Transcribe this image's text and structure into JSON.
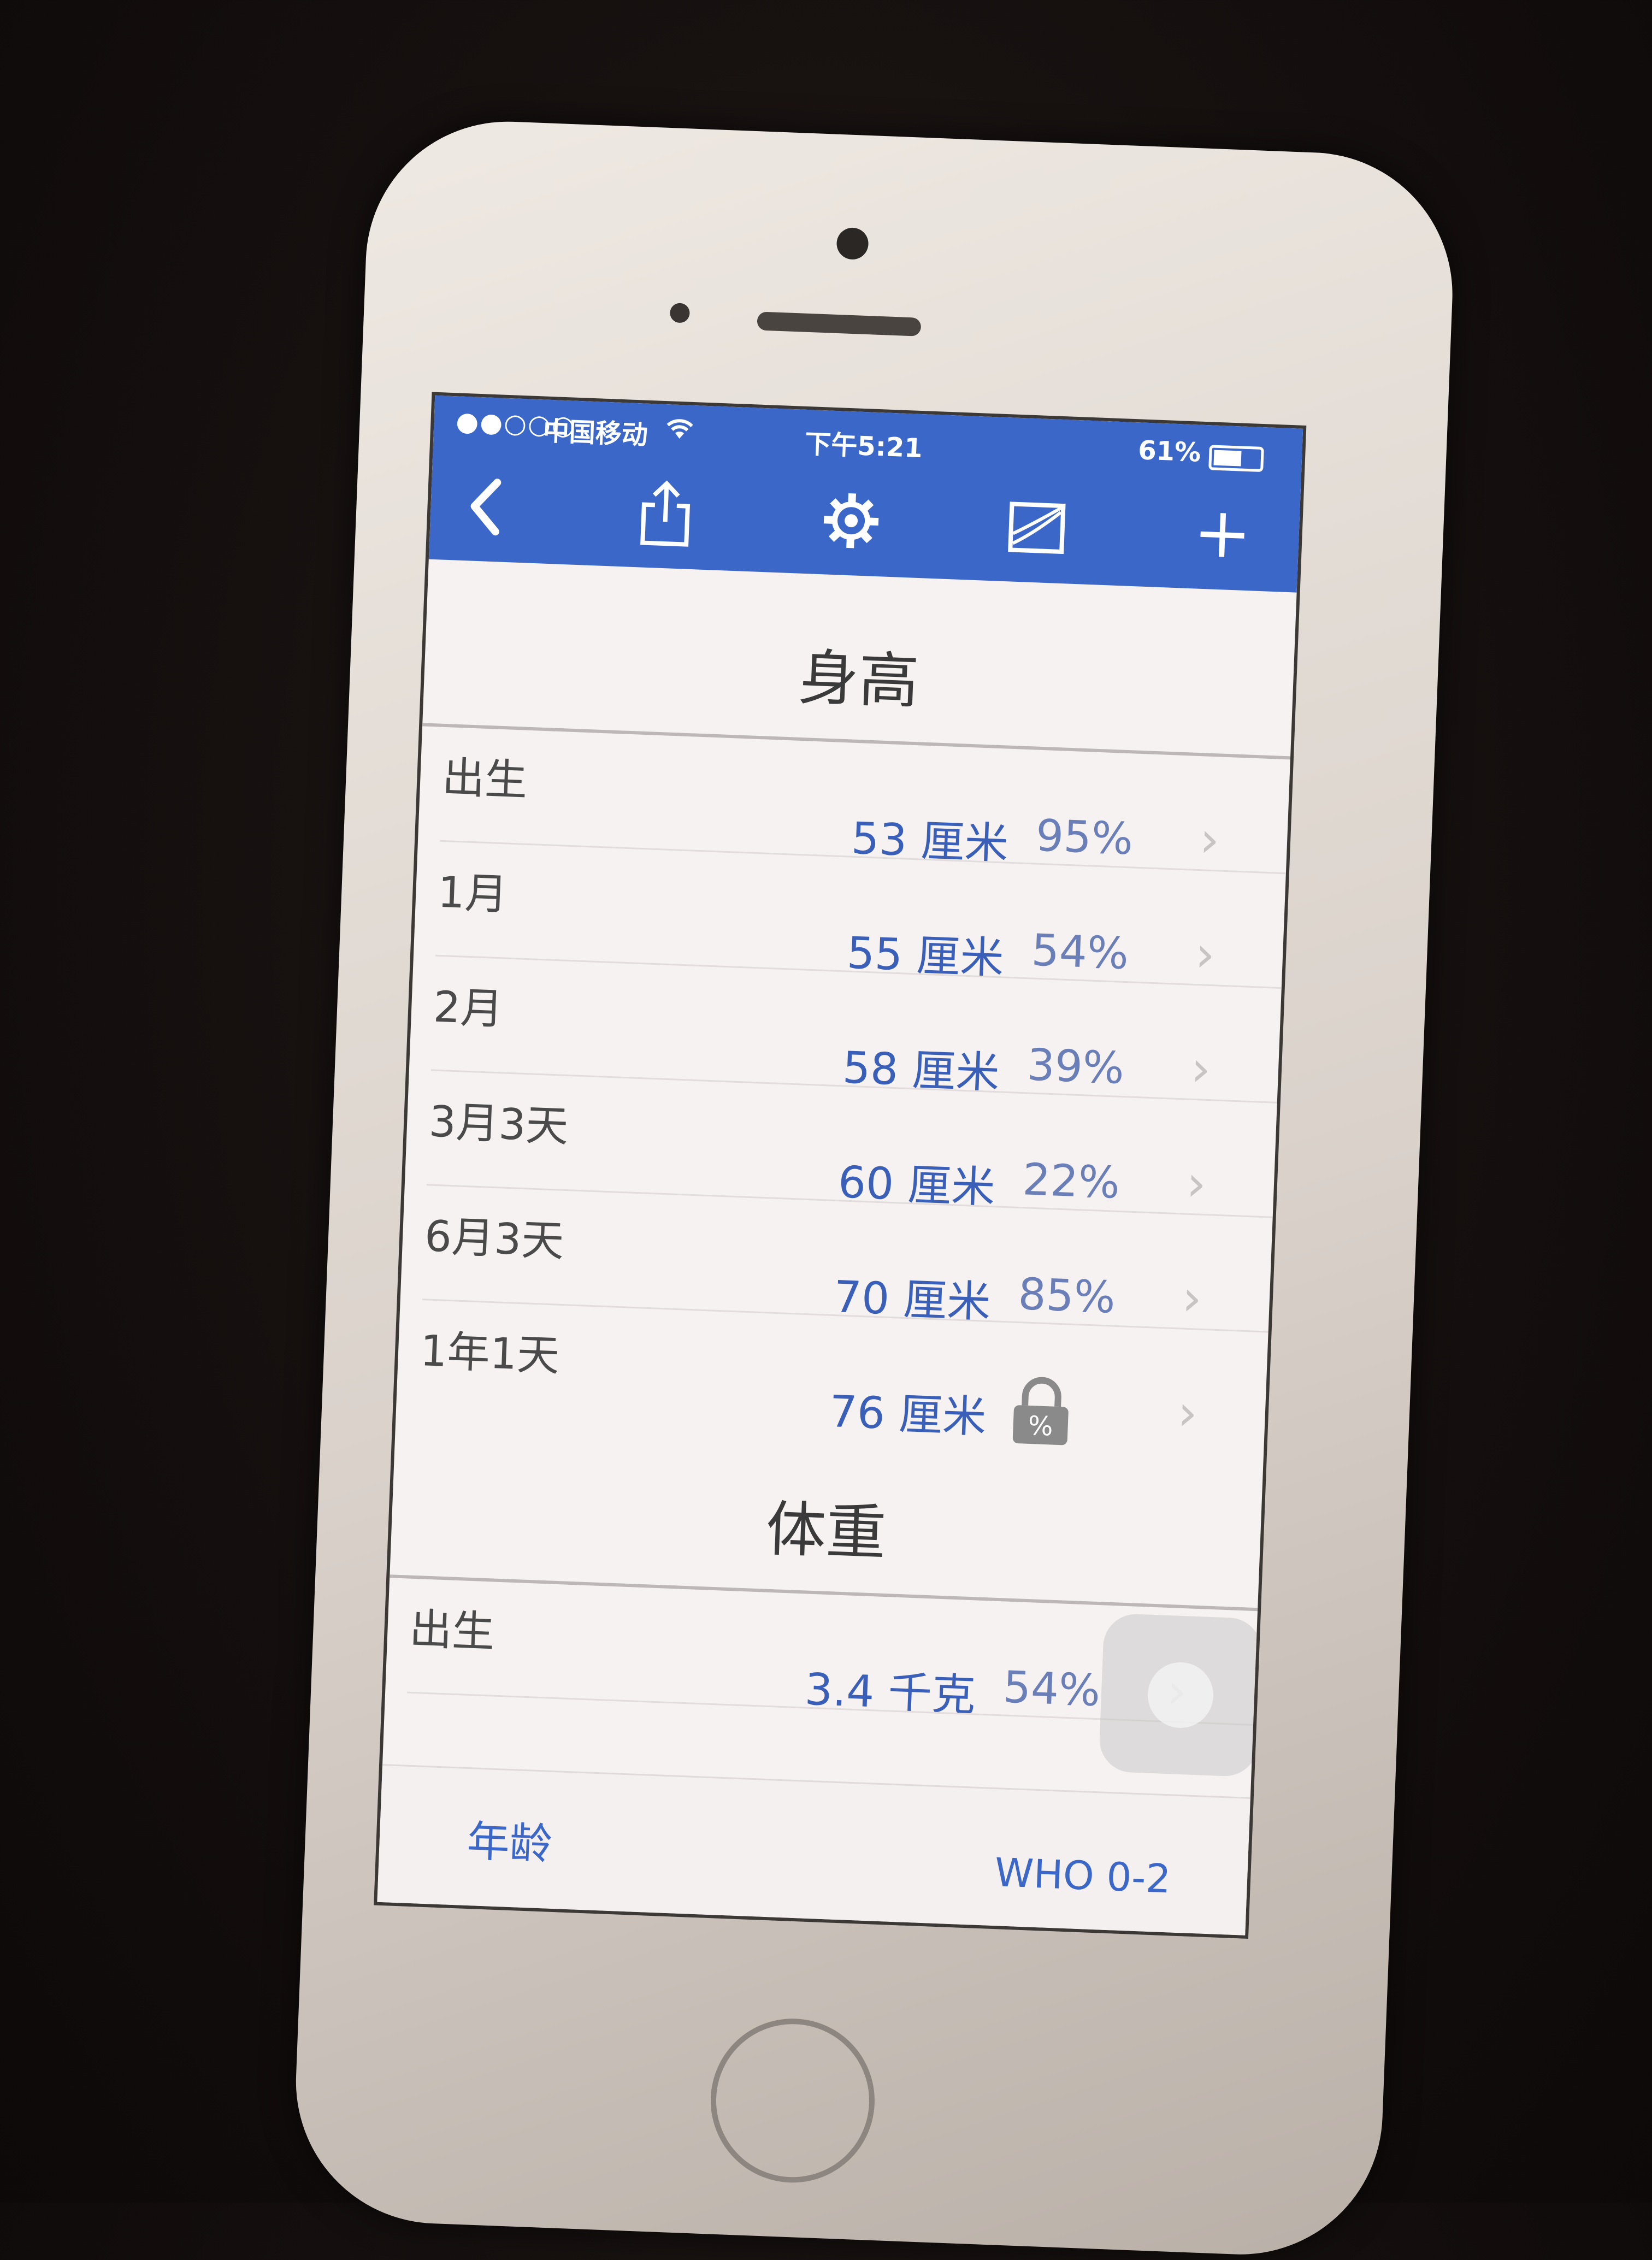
{
  "status_bar": {
    "signal": "●●○○○",
    "carrier": "中国移动",
    "time": "下午5:21",
    "battery_percent": "61%",
    "battery_level": 0.61
  },
  "toolbar": {
    "back_icon": "chevron-left-icon",
    "share_icon": "share-icon",
    "settings_icon": "gear-icon",
    "chart_icon": "chart-icon",
    "add_icon": "plus-icon"
  },
  "height_section": {
    "title": "身高",
    "rows": [
      {
        "label": "出生",
        "value": "53 厘米",
        "percentile": "95%"
      },
      {
        "label": "1月",
        "value": "55 厘米",
        "percentile": "54%"
      },
      {
        "label": "2月",
        "value": "58 厘米",
        "percentile": "39%"
      },
      {
        "label": "3月3天",
        "value": "60 厘米",
        "percentile": "22%"
      },
      {
        "label": "6月3天",
        "value": "70 厘米",
        "percentile": "85%"
      },
      {
        "label": "1年1天",
        "value": "76 厘米",
        "percentile_locked": true,
        "lock_symbol": "%"
      }
    ]
  },
  "weight_section": {
    "title": "体重",
    "rows": [
      {
        "label": "出生",
        "value": "3.4 千克",
        "percentile": "54%"
      }
    ]
  },
  "bottom_bar": {
    "left_label": "年龄",
    "right_label": "WHO 0-2"
  },
  "colors": {
    "accent": "#3b67c9",
    "value_text": "#3a5fb8"
  }
}
